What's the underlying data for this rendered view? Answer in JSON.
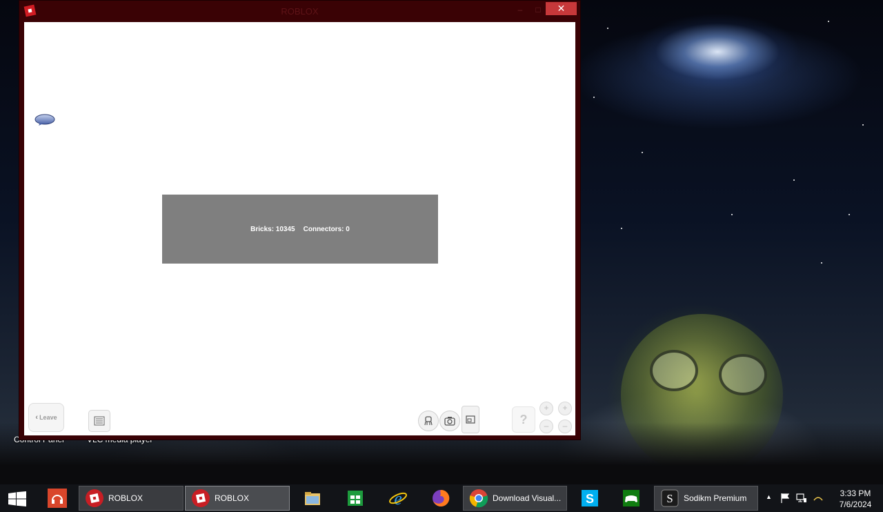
{
  "desktop": {
    "icons": [
      {
        "label": "Control Panel"
      },
      {
        "label": "VLC media player"
      }
    ]
  },
  "window": {
    "title": "ROBLOX",
    "minimize": "–",
    "maximize": "□",
    "close": "✕"
  },
  "game": {
    "stats": {
      "bricks": "Bricks: 10345",
      "connectors": "Connectors: 0"
    },
    "leave_label": "Leave",
    "help_label": "?"
  },
  "taskbar": {
    "items": [
      {
        "label": "ROBLOX",
        "icon": "roblox-icon"
      },
      {
        "label": "ROBLOX",
        "icon": "roblox-icon"
      },
      {
        "label": "",
        "icon": "file-explorer-icon"
      },
      {
        "label": "",
        "icon": "store-icon"
      },
      {
        "label": "",
        "icon": "internet-explorer-icon"
      },
      {
        "label": "",
        "icon": "firefox-icon"
      },
      {
        "label": "Download Visual...",
        "icon": "chrome-icon"
      },
      {
        "label": "",
        "icon": "skype-icon"
      },
      {
        "label": "",
        "icon": "games-icon"
      },
      {
        "label": "Sodikm Premium",
        "icon": "sodikm-icon"
      }
    ],
    "clock": {
      "time": "3:33 PM",
      "date": "7/6/2024"
    }
  },
  "colors": {
    "window_frame": "#3a0205",
    "close_button": "#c7383a",
    "stats_panel": "#7f7f7f",
    "taskbar": "#121418"
  }
}
